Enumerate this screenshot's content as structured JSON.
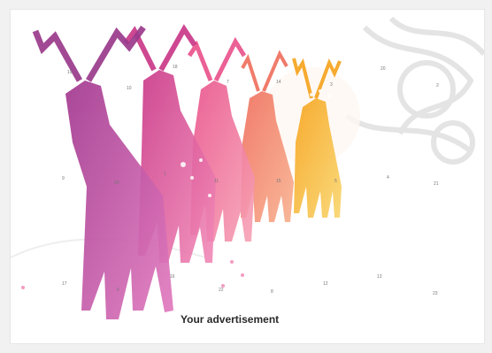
{
  "calendar": {
    "caption": "Your advertisement",
    "door_numbers": [
      "19",
      "18",
      "7",
      "14",
      "3",
      "20",
      "2",
      "9",
      "24",
      "1",
      "11",
      "15",
      "5",
      "4",
      "21",
      "17",
      "6",
      "22",
      "12",
      "13",
      "23",
      "16",
      "8",
      "10"
    ],
    "theme": {
      "background": "#ffffff",
      "reindeer_colors": [
        "#9b3a8c",
        "#d4418f",
        "#ea5f8f",
        "#f07a5e",
        "#f5a21e"
      ],
      "snow": "#ffffff",
      "ornament": "#e3e3e3"
    }
  }
}
